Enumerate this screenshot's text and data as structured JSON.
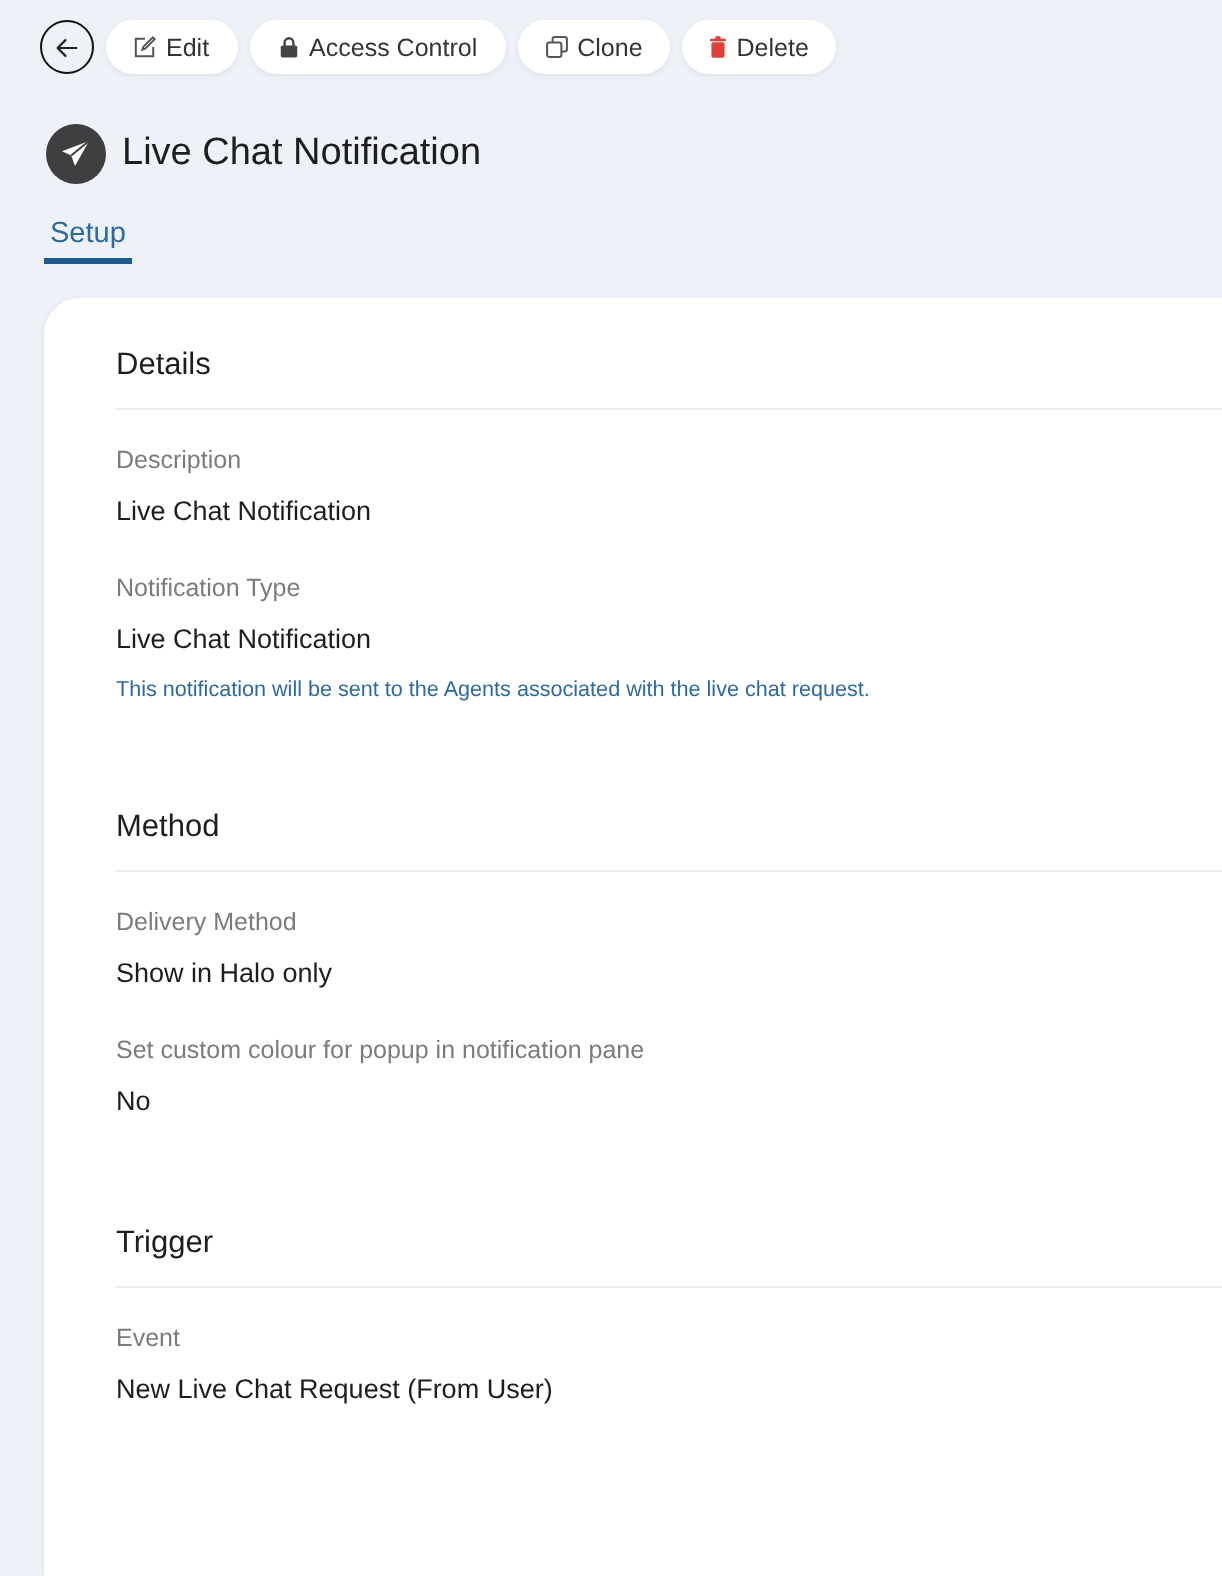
{
  "toolbar": {
    "buttons": [
      {
        "label": "Edit",
        "kind": "edit"
      },
      {
        "label": "Access Control",
        "kind": "lock"
      },
      {
        "label": "Clone",
        "kind": "clone"
      },
      {
        "label": "Delete",
        "kind": "delete"
      }
    ]
  },
  "page": {
    "title": "Live Chat Notification"
  },
  "tabs": [
    {
      "label": "Setup",
      "selected": true
    }
  ],
  "sections": [
    {
      "title": "Details",
      "fields": [
        {
          "label": "Description",
          "value": "Live Chat Notification"
        },
        {
          "label": "Notification Type",
          "value": "Live Chat Notification",
          "hint": "This notification will be sent to the Agents associated with the live chat request."
        }
      ]
    },
    {
      "title": "Method",
      "fields": [
        {
          "label": "Delivery Method",
          "value": "Show in Halo only"
        },
        {
          "label": "Set custom colour for popup in notification pane",
          "value": "No"
        }
      ]
    },
    {
      "title": "Trigger",
      "fields": [
        {
          "label": "Event",
          "value": "New Live Chat Request (From User)"
        }
      ]
    }
  ]
}
